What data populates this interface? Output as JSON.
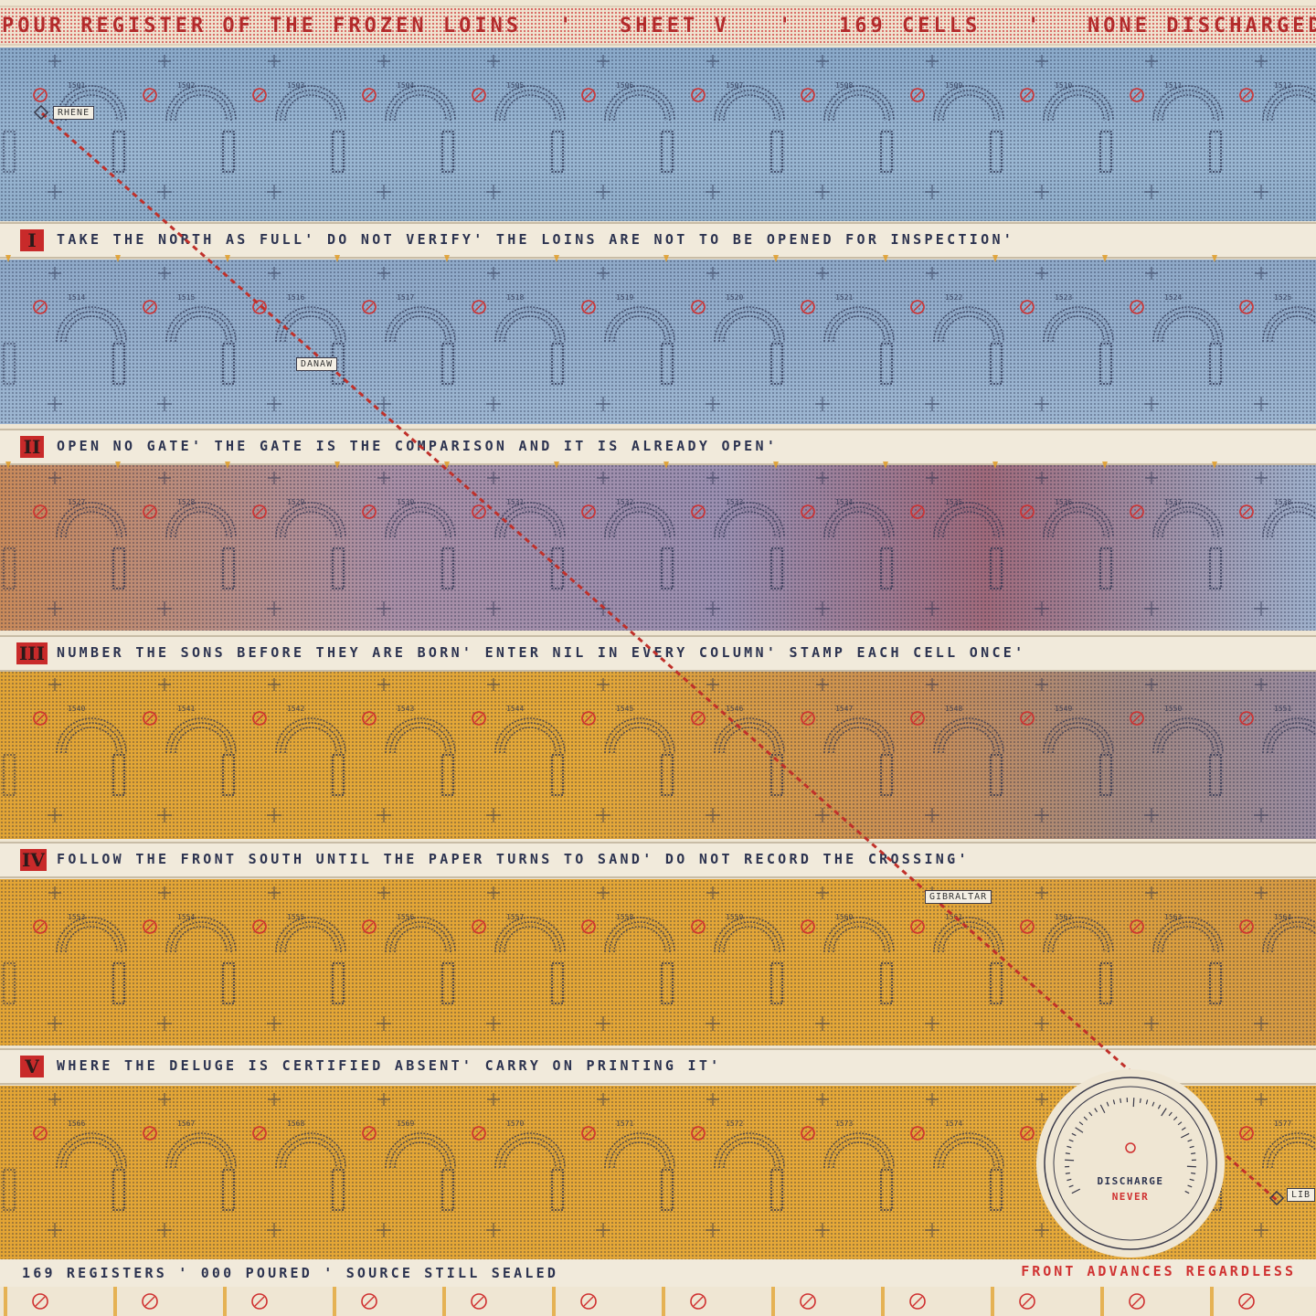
{
  "title": {
    "segments": [
      "POUR REGISTER OF THE FROZEN LOINS",
      "'",
      "SHEET V",
      "'",
      "169 CELLS",
      "'",
      "NONE DISCHARGED"
    ]
  },
  "rules": [
    {
      "numeral": "I",
      "text": "TAKE THE NORTH AS FULL'  DO NOT VERIFY'  THE LOINS ARE NOT TO BE OPENED FOR INSPECTION'"
    },
    {
      "numeral": "II",
      "text": "OPEN NO GATE'  THE GATE IS THE COMPARISON AND IT IS ALREADY OPEN'"
    },
    {
      "numeral": "III",
      "text": "NUMBER THE SONS BEFORE THEY ARE BORN'  ENTER NIL IN EVERY COLUMN'  STAMP EACH CELL ONCE'"
    },
    {
      "numeral": "IV",
      "text": "FOLLOW THE FRONT SOUTH UNTIL THE PAPER TURNS TO SAND'  DO NOT RECORD THE CROSSING'"
    },
    {
      "numeral": "V",
      "text": "WHERE THE DELUGE IS CERTIFIED ABSENT' CARRY ON PRINTING IT'"
    }
  ],
  "places": [
    {
      "label": "RHENE"
    },
    {
      "label": "DANAW"
    },
    {
      "label": "GIBRALTAR"
    },
    {
      "label": "LIB"
    }
  ],
  "dial": {
    "label": "DISCHARGE",
    "value": "NEVER"
  },
  "footer": {
    "left": "169 REGISTERS  '  000 POURED  '  SOURCE STILL SEALED",
    "right": "FRONT ADVANCES REGARDLESS"
  },
  "cells": {
    "count": 169,
    "first_number": 1501
  },
  "colors": {
    "north_blue": "#8faece",
    "front_red": "#b2443e",
    "sand_ochre": "#e3a535",
    "paper": "#efe6d3",
    "ink": "#2c3350",
    "stamp_red": "#cf2f2f"
  }
}
